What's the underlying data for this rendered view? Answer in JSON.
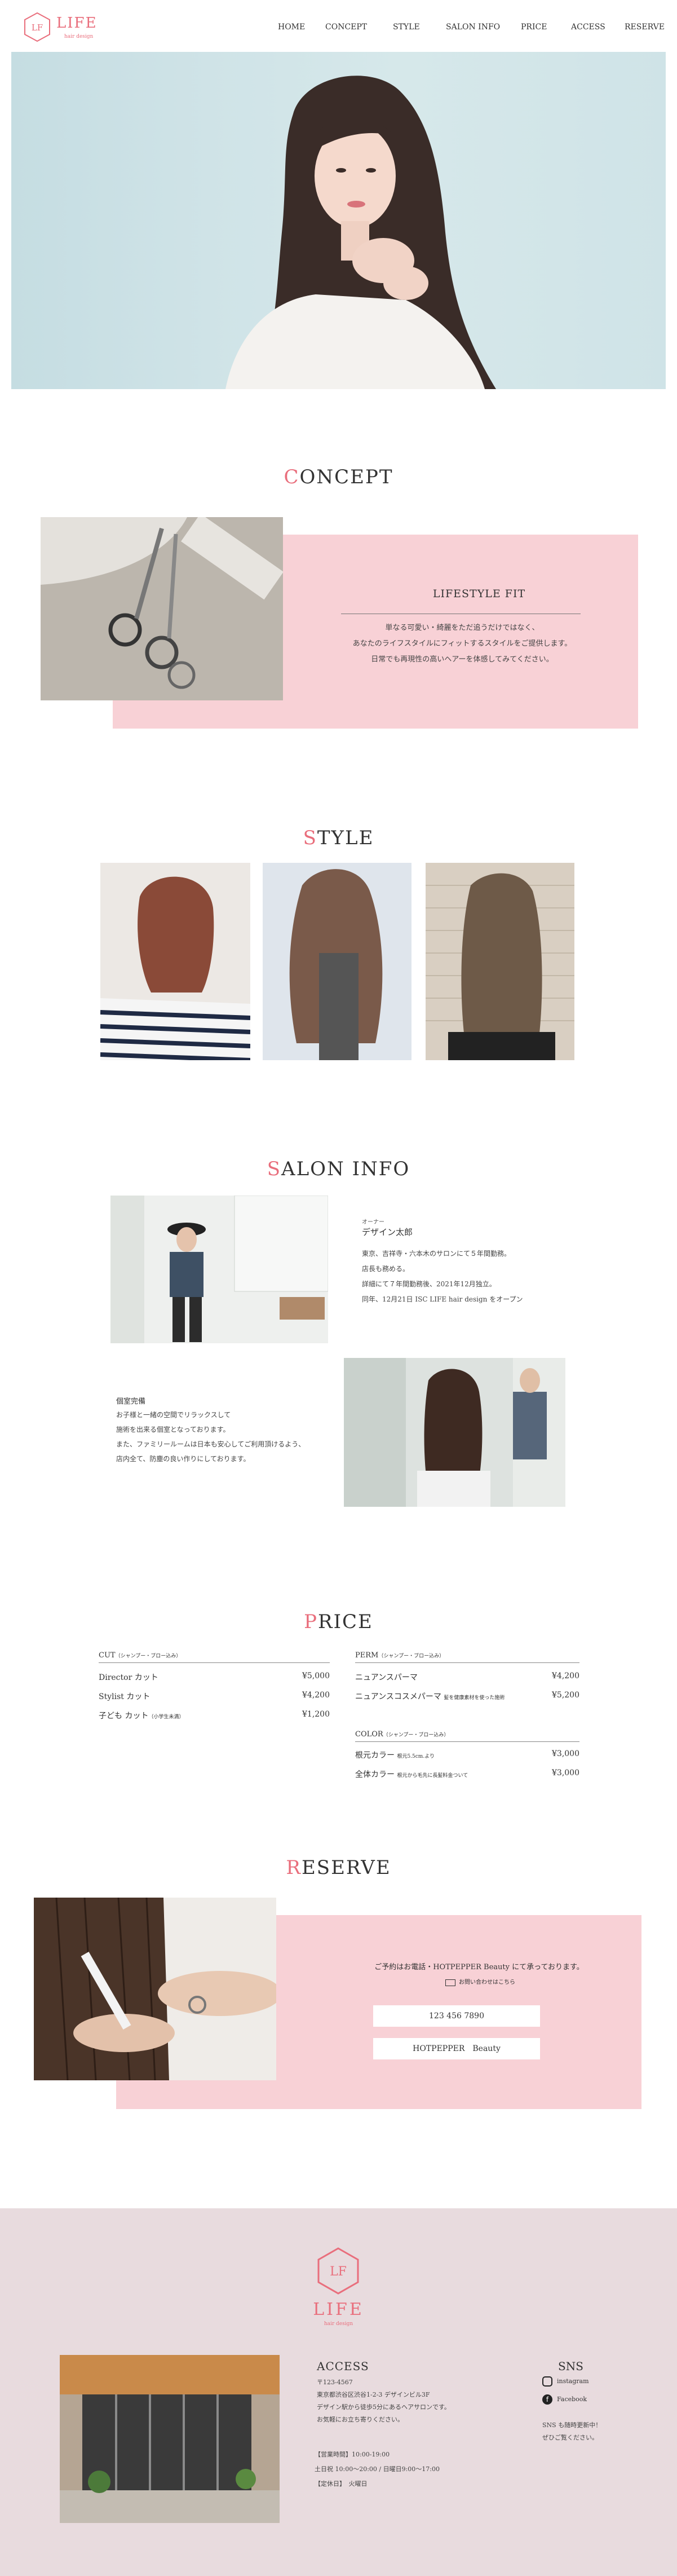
{
  "brand": {
    "logo_text": "LIFE",
    "logo_sub": "hair design",
    "logo_mark": "LF"
  },
  "nav": [
    {
      "label": "HOME"
    },
    {
      "label": "CONCEPT"
    },
    {
      "label": "STYLE"
    },
    {
      "label": "SALON INFO"
    },
    {
      "label": "PRICE"
    },
    {
      "label": "ACCESS"
    },
    {
      "label": "RESERVE"
    }
  ],
  "concept": {
    "title_first": "C",
    "title_rest": "ONCEPT",
    "heading": "LIFESTYLE FIT",
    "lines": [
      "単なる可愛い・綺麗をただ追うだけではなく、",
      "あなたのライフスタイルにフィットするスタイルをご提供します。",
      "日常でも再現性の高いヘアーを体感してみてください。"
    ]
  },
  "style": {
    "title_first": "S",
    "title_rest": "TYLE"
  },
  "salon": {
    "title_first": "S",
    "title_rest": "ALON INFO",
    "owner_role": "オーナー",
    "owner_name": "デザイン太郎",
    "owner_lines": [
      "東京、吉祥寺・六本木のサロンにて５年間勤務。",
      "店長も務める。",
      "詳細にて７年間勤務後、2021年12月独立。",
      "同年、12月21日 ISC LIFE hair design をオープン"
    ],
    "room_title": "個室完備",
    "room_lines": [
      "お子様と一緒の空間でリラックスして",
      "施術を出来る個室となっております。",
      "また、ファミリールームは日本も安心してご利用頂けるよう、",
      "店内全て、防塵の良い作りにしております。"
    ]
  },
  "price": {
    "title_first": "P",
    "title_rest": "RICE",
    "cut": {
      "heading": "CUT",
      "note": "（シャンプー・ブロー込み）",
      "items": [
        {
          "name": "Director カット",
          "price": "¥5,000"
        },
        {
          "name": "Stylist カット",
          "price": "¥4,200"
        },
        {
          "name": "子ども カット",
          "sub": "（小学生未満）",
          "price": "¥1,200"
        }
      ]
    },
    "perm": {
      "heading": "PERM",
      "note": "（シャンプー・ブロー込み）",
      "items": [
        {
          "name": "ニュアンスパーマ",
          "price": "¥4,200"
        },
        {
          "name": "ニュアンスコスメパーマ",
          "sub": "髪を健康素材を使った施術",
          "price": "¥5,200"
        }
      ]
    },
    "color": {
      "heading": "COLOR",
      "note": "（シャンプー・ブロー込み）",
      "items": [
        {
          "name": "根元カラー",
          "sub": "根元5.5cm.より",
          "price": "¥3,000"
        },
        {
          "name": "全体カラー",
          "sub": "根元から毛先に長髪料金ついて",
          "price": "¥3,000"
        }
      ]
    }
  },
  "reserve": {
    "title_first": "R",
    "title_rest": "ESERVE",
    "lead": "ご予約はお電話・HOTPEPPER Beauty にて承っております。",
    "mail_note": "お問い合わせはこちら",
    "phone": "123 456 7890",
    "hotpepper": "HOTPEPPER　Beauty"
  },
  "footer": {
    "access_title": "ACCESS",
    "address_lines": [
      "〒123-4567",
      "東京都渋谷区渋谷1-2-3 デザインビル3F",
      "デザイン駅から徒歩5分にあるヘアサロンです。",
      "お気軽にお立ち寄りください。"
    ],
    "hours": "【営業時間】10:00-19:00",
    "hours2": "土日祝 10:00～20:00 / 日曜日9:00～17:00",
    "holiday": "【定休日】　火曜日",
    "sns_title": "SNS",
    "instagram": "instagram",
    "facebook": "Facebook",
    "sns_note1": "SNS も随時更新中！",
    "sns_note2": "ぜひご覧ください。"
  },
  "colors": {
    "accent": "#e96e7c",
    "pink": "#f8d1d6",
    "footer_bg": "#e8dbde"
  }
}
